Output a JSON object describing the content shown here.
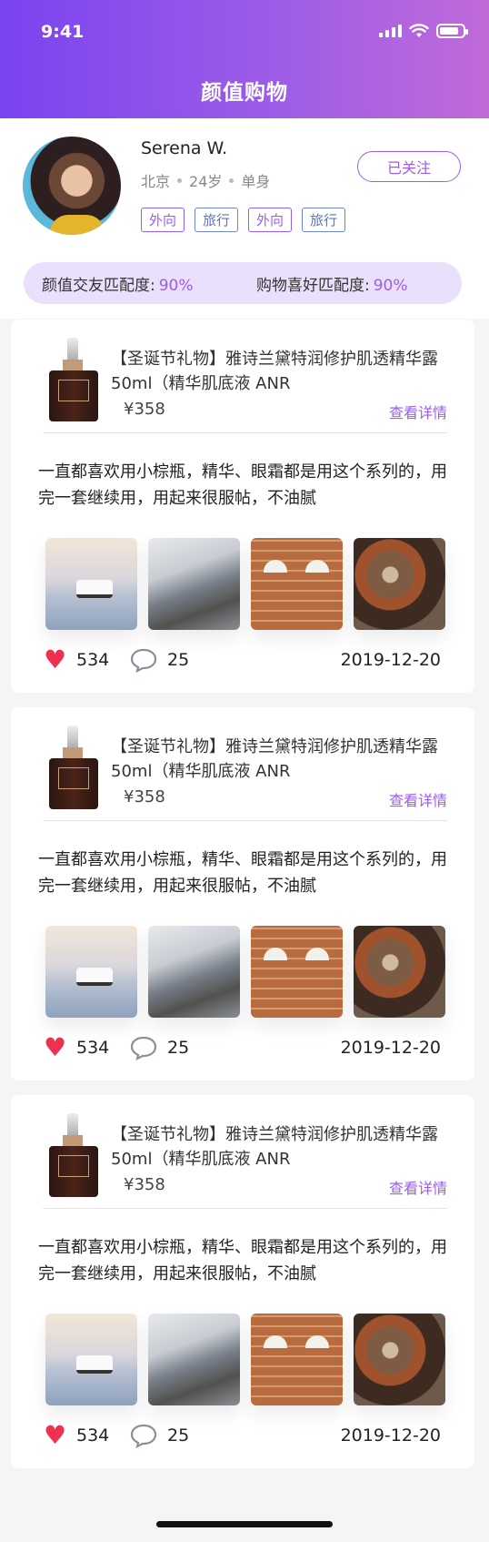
{
  "status_bar": {
    "time": "9:41"
  },
  "header": {
    "title": "颜值购物"
  },
  "profile": {
    "name": "Serena W.",
    "city": "北京",
    "age": "24岁",
    "relationship": "单身",
    "follow_label": "已关注",
    "tags": [
      "外向",
      "旅行",
      "外向",
      "旅行"
    ],
    "match_face_label": "颜值交友匹配度:",
    "match_face_value": "90%",
    "match_shop_label": "购物喜好匹配度:",
    "match_shop_value": "90%"
  },
  "posts": [
    {
      "product_title": "【圣诞节礼物】雅诗兰黛特润修护肌透精华露 50ml（精华肌底液 ANR",
      "price": "¥358",
      "detail_label": "查看详情",
      "text": "一直都喜欢用小棕瓶，精华、眼霜都是用这个系列的，用完一套继续用，用起来很服帖，不油腻",
      "likes": "534",
      "comments": "25",
      "date": "2019-12-20"
    },
    {
      "product_title": "【圣诞节礼物】雅诗兰黛特润修护肌透精华露 50ml（精华肌底液 ANR",
      "price": "¥358",
      "detail_label": "查看详情",
      "text": "一直都喜欢用小棕瓶，精华、眼霜都是用这个系列的，用完一套继续用，用起来很服帖，不油腻",
      "likes": "534",
      "comments": "25",
      "date": "2019-12-20"
    },
    {
      "product_title": "【圣诞节礼物】雅诗兰黛特润修护肌透精华露 50ml（精华肌底液 ANR",
      "price": "¥358",
      "detail_label": "查看详情",
      "text": "一直都喜欢用小棕瓶，精华、眼霜都是用这个系列的，用完一套继续用，用起来很服帖，不油腻",
      "likes": "534",
      "comments": "25",
      "date": "2019-12-20"
    }
  ],
  "colors": {
    "accent": "#9a5ee8",
    "like": "#f0304f",
    "header_start": "#7a43f0",
    "header_end": "#c06ad8"
  },
  "icons": [
    "signal-icon",
    "wifi-icon",
    "battery-icon",
    "heart-icon",
    "comment-icon"
  ]
}
